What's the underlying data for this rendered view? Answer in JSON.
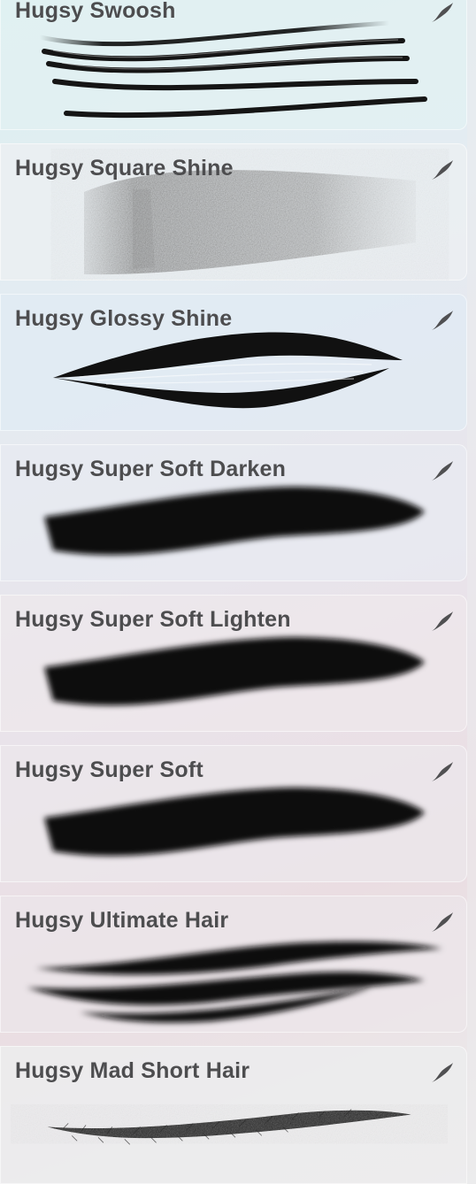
{
  "brushes": [
    {
      "name": "Hugsy Swoosh",
      "icon": "brush-stroke-icon"
    },
    {
      "name": "Hugsy Square Shine",
      "icon": "brush-stroke-icon"
    },
    {
      "name": "Hugsy Glossy Shine",
      "icon": "brush-stroke-icon"
    },
    {
      "name": "Hugsy Super Soft Darken",
      "icon": "brush-stroke-icon"
    },
    {
      "name": "Hugsy Super Soft Lighten",
      "icon": "brush-stroke-icon"
    },
    {
      "name": "Hugsy Super Soft",
      "icon": "brush-stroke-icon"
    },
    {
      "name": "Hugsy Ultimate Hair",
      "icon": "brush-stroke-icon"
    },
    {
      "name": "Hugsy Mad Short Hair",
      "icon": "brush-stroke-icon"
    }
  ],
  "colors": {
    "label": "#4d4d4f",
    "icon": "#505052",
    "stroke": "#111111"
  }
}
